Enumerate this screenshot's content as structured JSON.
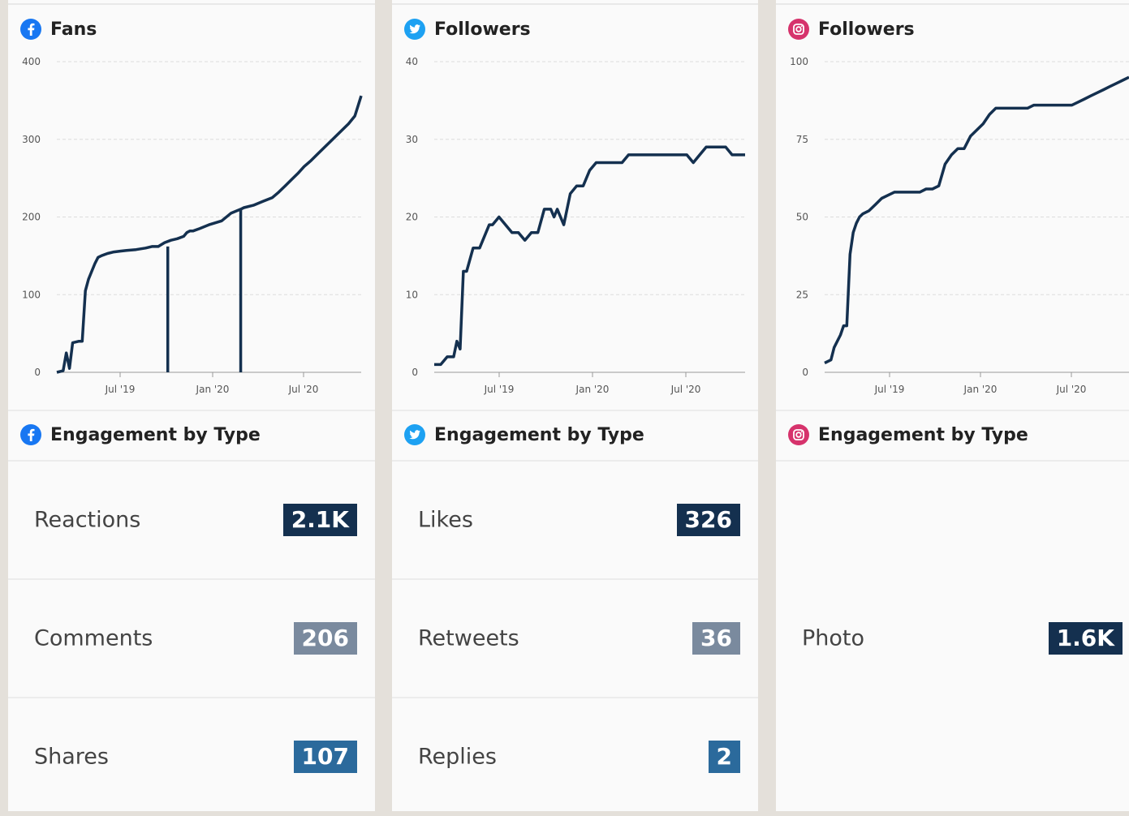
{
  "colors": {
    "line": "#14304f",
    "badge_dark": "#14304f",
    "badge_gray": "#7a8a9e",
    "badge_blue": "#2b6a9c",
    "facebook": "#1877f2",
    "twitter": "#1da1f2",
    "instagram": "#d6336c"
  },
  "panels": [
    {
      "platform_icon": "facebook-icon",
      "chart_title": "Fans",
      "engagement_title": "Engagement by Type",
      "rows": [
        {
          "label": "Reactions",
          "value": "2.1K",
          "color": "#14304f"
        },
        {
          "label": "Comments",
          "value": "206",
          "color": "#7a8a9e"
        },
        {
          "label": "Shares",
          "value": "107",
          "color": "#2b6a9c"
        }
      ]
    },
    {
      "platform_icon": "twitter-icon",
      "chart_title": "Followers",
      "engagement_title": "Engagement by Type",
      "rows": [
        {
          "label": "Likes",
          "value": "326",
          "color": "#14304f"
        },
        {
          "label": "Retweets",
          "value": "36",
          "color": "#7a8a9e"
        },
        {
          "label": "Replies",
          "value": "2",
          "color": "#2b6a9c"
        }
      ]
    },
    {
      "platform_icon": "instagram-icon",
      "chart_title": "Followers",
      "engagement_title": "Engagement by Type",
      "rows": [
        {
          "label": "Photo",
          "value": "1.6K",
          "color": "#14304f"
        }
      ]
    }
  ],
  "chart_data": [
    {
      "type": "line",
      "title": "Fans",
      "ylim": [
        0,
        400
      ],
      "yticks": [
        "0",
        "100",
        "200",
        "300",
        "400"
      ],
      "xticks": [
        "Jul '19",
        "Jan '20",
        "Jul '20"
      ],
      "grid": "horizontal-dashed",
      "x": [
        0,
        2,
        3,
        4,
        5,
        7,
        8,
        9,
        10,
        11,
        12,
        13,
        14,
        16,
        18,
        20,
        22,
        25,
        28,
        30,
        32,
        34,
        36,
        38,
        40,
        41,
        41,
        42,
        43,
        45,
        48,
        52,
        55,
        58,
        58,
        59,
        62,
        65,
        68,
        70,
        72,
        74,
        76,
        78,
        80,
        82,
        84,
        86,
        88,
        90,
        92,
        94,
        95,
        96
      ],
      "y": [
        0,
        2,
        25,
        5,
        38,
        40,
        40,
        105,
        120,
        130,
        140,
        148,
        150,
        153,
        155,
        156,
        157,
        158,
        160,
        162,
        162,
        167,
        170,
        172,
        175,
        180,
        180,
        182,
        182,
        185,
        190,
        195,
        205,
        210,
        210,
        212,
        215,
        220,
        225,
        232,
        240,
        248,
        256,
        265,
        272,
        280,
        288,
        296,
        304,
        312,
        320,
        330,
        343,
        356
      ]
    },
    {
      "type": "line",
      "title": "Followers",
      "ylim": [
        0,
        40
      ],
      "yticks": [
        "0",
        "10",
        "20",
        "30",
        "40"
      ],
      "xticks": [
        "Jul '19",
        "Jan '20",
        "Jul '20"
      ],
      "grid": "horizontal-dashed",
      "x": [
        0,
        2,
        4,
        6,
        7,
        8,
        9,
        10,
        12,
        14,
        16,
        17,
        18,
        20,
        22,
        24,
        26,
        28,
        30,
        32,
        34,
        36,
        37,
        38,
        40,
        42,
        44,
        46,
        48,
        50,
        52,
        54,
        56,
        58,
        60,
        62,
        66,
        70,
        72,
        74,
        76,
        78,
        80,
        82,
        84,
        86,
        88,
        90,
        92,
        94,
        96
      ],
      "y": [
        1,
        1,
        2,
        2,
        4,
        3,
        13,
        13,
        16,
        16,
        18,
        19,
        19,
        20,
        19,
        18,
        18,
        17,
        18,
        18,
        21,
        21,
        20,
        21,
        19,
        23,
        24,
        24,
        26,
        27,
        27,
        27,
        27,
        27,
        28,
        28,
        28,
        28,
        28,
        28,
        28,
        28,
        27,
        28,
        29,
        29,
        29,
        29,
        28,
        28,
        28
      ]
    },
    {
      "type": "line",
      "title": "Followers",
      "ylim": [
        0,
        100
      ],
      "yticks": [
        "0",
        "25",
        "50",
        "75",
        "100"
      ],
      "xticks": [
        "Jul '19",
        "Jan '20",
        "Jul '20"
      ],
      "grid": "horizontal-dashed",
      "x": [
        0,
        2,
        3,
        4,
        5,
        6,
        7,
        8,
        9,
        10,
        11,
        12,
        14,
        16,
        18,
        20,
        22,
        24,
        26,
        28,
        30,
        32,
        34,
        36,
        38,
        40,
        42,
        44,
        46,
        48,
        50,
        52,
        54,
        56,
        58,
        60,
        62,
        64,
        66,
        68,
        70,
        72,
        74,
        76,
        78,
        80,
        82,
        84,
        86,
        88,
        90,
        92,
        94,
        96
      ],
      "y": [
        3,
        4,
        8,
        10,
        12,
        15,
        15,
        38,
        45,
        48,
        50,
        51,
        52,
        54,
        56,
        57,
        58,
        58,
        58,
        58,
        58,
        59,
        59,
        60,
        67,
        70,
        72,
        72,
        76,
        78,
        80,
        83,
        85,
        85,
        85,
        85,
        85,
        85,
        86,
        86,
        86,
        86,
        86,
        86,
        86,
        87,
        88,
        89,
        90,
        91,
        92,
        93,
        94,
        95
      ]
    }
  ]
}
